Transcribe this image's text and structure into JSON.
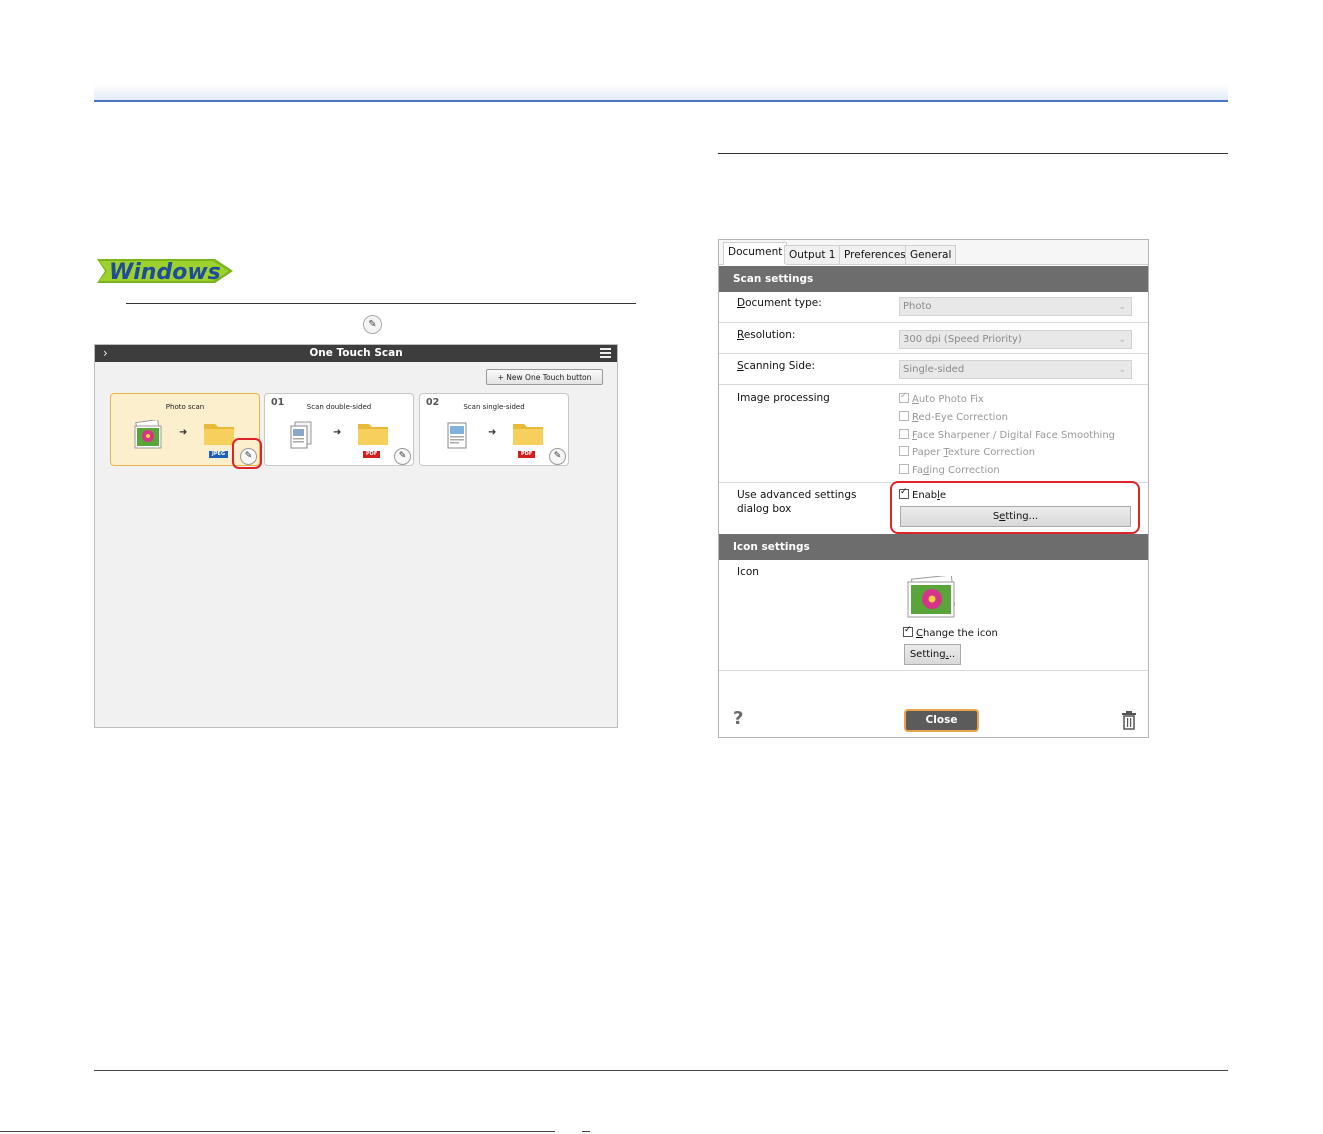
{
  "windows_logo_text": "Windows",
  "inline_icon": "pencil-icon",
  "one_touch_scan": {
    "title": "One Touch Scan",
    "new_button": "+ New One Touch button",
    "cards": [
      {
        "num": "",
        "caption": "Photo scan",
        "badge": "JPEG",
        "badge_color": "#1d5fb7"
      },
      {
        "num": "01",
        "caption": "Scan double-sided",
        "badge": "PDF",
        "badge_color": "#d3201f"
      },
      {
        "num": "02",
        "caption": "Scan single-sided",
        "badge": "PDF",
        "badge_color": "#d3201f"
      }
    ]
  },
  "dialog": {
    "tabs": [
      "Document",
      "Output 1",
      "Preferences",
      "General"
    ],
    "scan_settings_header": "Scan settings",
    "document_type": {
      "label_u": "D",
      "label_rest": "ocument type:",
      "value": "Photo"
    },
    "resolution": {
      "label_u": "R",
      "label_rest": "esolution:",
      "value": "300 dpi (Speed Priority)"
    },
    "scanning_side": {
      "label_u": "S",
      "label_rest": "canning Side:",
      "value": "Single-sided"
    },
    "image_processing": {
      "label": "Image processing",
      "options": [
        {
          "u": "A",
          "rest": "uto Photo Fix",
          "checked": true
        },
        {
          "u": "R",
          "rest": "ed-Eye Correction",
          "checked": false
        },
        {
          "u": "F",
          "rest": "ace Sharpener / Digital Face Smoothing",
          "checked": false
        },
        {
          "pre": "Paper ",
          "u": "T",
          "rest": "exture Correction",
          "checked": false
        },
        {
          "pre": "Fa",
          "u": "d",
          "rest": "ing Correction",
          "checked": false
        }
      ]
    },
    "advanced": {
      "label": "Use advanced settings dialog box",
      "enable_pre": "Enab",
      "enable_u": "l",
      "enable_rest": "e",
      "setting_pre": "S",
      "setting_u": "e",
      "setting_rest": "tting..."
    },
    "icon_settings_header": "Icon settings",
    "icon_label": "Icon",
    "change_icon_u": "C",
    "change_icon_rest": "hange the icon",
    "icon_setting_pre": "Setting",
    "icon_setting_u": ".",
    "icon_setting_rest": "..",
    "close_label": "Close",
    "help_glyph": "?"
  },
  "colors": {
    "accent_blue": "#4a74c4",
    "highlight_red": "#e0232a",
    "selected_card": "#fcefcd"
  }
}
